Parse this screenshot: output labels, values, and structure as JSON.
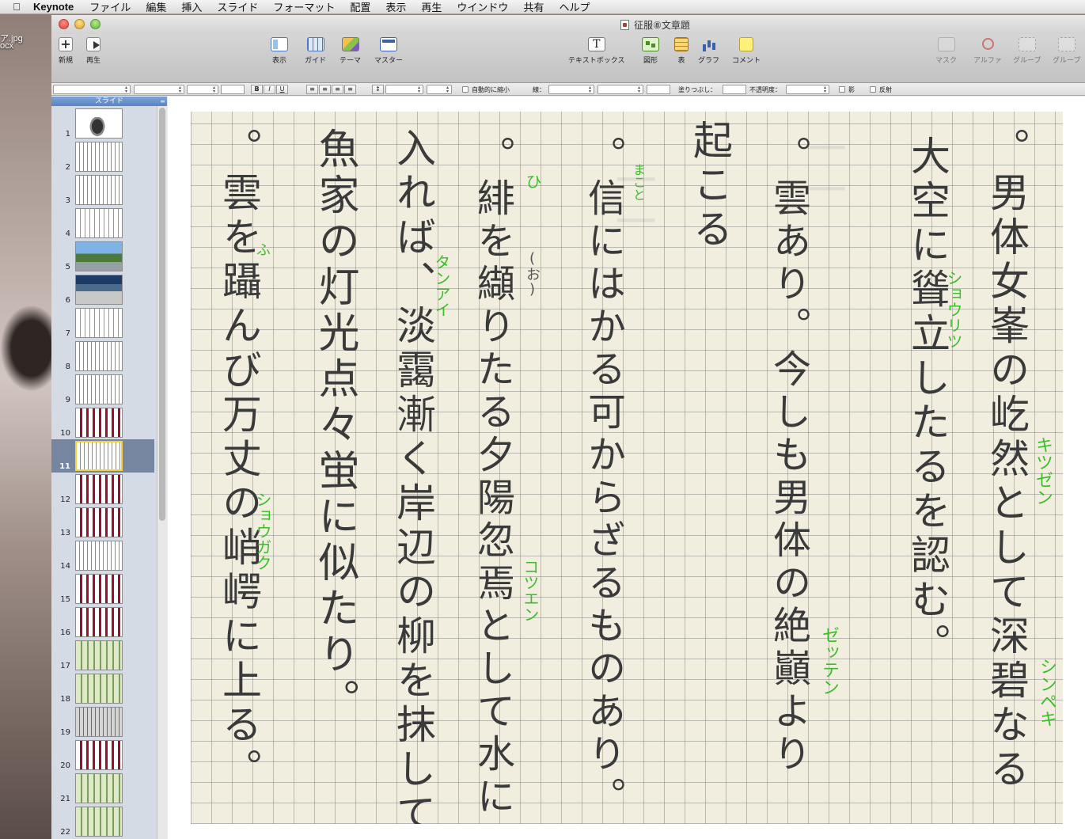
{
  "menubar": {
    "app": "Keynote",
    "items": [
      "ファイル",
      "編集",
      "挿入",
      "スライド",
      "フォーマット",
      "配置",
      "表示",
      "再生",
      "ウインドウ",
      "共有",
      "ヘルプ"
    ]
  },
  "desktop": {
    "labels": [
      "ア.jpg",
      "ocx"
    ]
  },
  "window": {
    "title": "征服⑧文章題"
  },
  "toolbar": {
    "new": "新規",
    "play": "再生",
    "view": "表示",
    "guide": "ガイド",
    "theme": "テーマ",
    "master": "マスター",
    "textbox": "テキストボックス",
    "shape": "図形",
    "table": "表",
    "chart": "グラフ",
    "comment": "コメント",
    "mask": "マスク",
    "alpha": "アルファ",
    "group": "グループ",
    "ungroup": "グループ"
  },
  "formatbar": {
    "bold": "B",
    "italic": "I",
    "underline": "U",
    "shrink": "自動的に縮小",
    "line": "線：",
    "fill": "塗りつぶし：",
    "opacity": "不透明度：",
    "shadow": "影",
    "reflection": "反射"
  },
  "navigator": {
    "header": "スライド",
    "selected": 11,
    "slides": [
      {
        "num": "1",
        "kind": "photo"
      },
      {
        "num": "2",
        "kind": "text"
      },
      {
        "num": "3",
        "kind": "text"
      },
      {
        "num": "4",
        "kind": "pink"
      },
      {
        "num": "5",
        "kind": "land1"
      },
      {
        "num": "6",
        "kind": "land2"
      },
      {
        "num": "7",
        "kind": "pink"
      },
      {
        "num": "8",
        "kind": "text"
      },
      {
        "num": "9",
        "kind": "text"
      },
      {
        "num": "10",
        "kind": "red"
      },
      {
        "num": "11",
        "kind": "text"
      },
      {
        "num": "12",
        "kind": "red"
      },
      {
        "num": "13",
        "kind": "red"
      },
      {
        "num": "14",
        "kind": "text"
      },
      {
        "num": "15",
        "kind": "red"
      },
      {
        "num": "16",
        "kind": "red"
      },
      {
        "num": "17",
        "kind": "green"
      },
      {
        "num": "18",
        "kind": "green"
      },
      {
        "num": "19",
        "kind": "gray"
      },
      {
        "num": "20",
        "kind": "red"
      },
      {
        "num": "21",
        "kind": "green"
      },
      {
        "num": "22",
        "kind": "green"
      }
    ]
  },
  "slide": {
    "columns": [
      "。男体女峯の屹然として深碧なる",
      "大空に聳立したるを認む。",
      "。雲あり。今しも男体の絶巓より",
      "起こる",
      "。信にはかる可からざるものあり。",
      "。緋を纈りたる夕陽忽焉として水に",
      "入れば、淡靄漸く岸辺の柳を抹して",
      "魚家の灯光点々蛍に似たり。",
      "。雲を躡んび万丈の峭崿に上る。"
    ],
    "ruby": {
      "kitsuzen": "キツゼン",
      "shinpeki": "シンペキ",
      "shouritsu": "ショウリツ",
      "zetten": "ゼッテン",
      "makoto": "まこと",
      "hi": "ひ",
      "o": "(お)",
      "kotsuen": "コツエン",
      "tanai": "タンアイ",
      "fu": "ふ",
      "shougaku": "ショウガク"
    }
  }
}
